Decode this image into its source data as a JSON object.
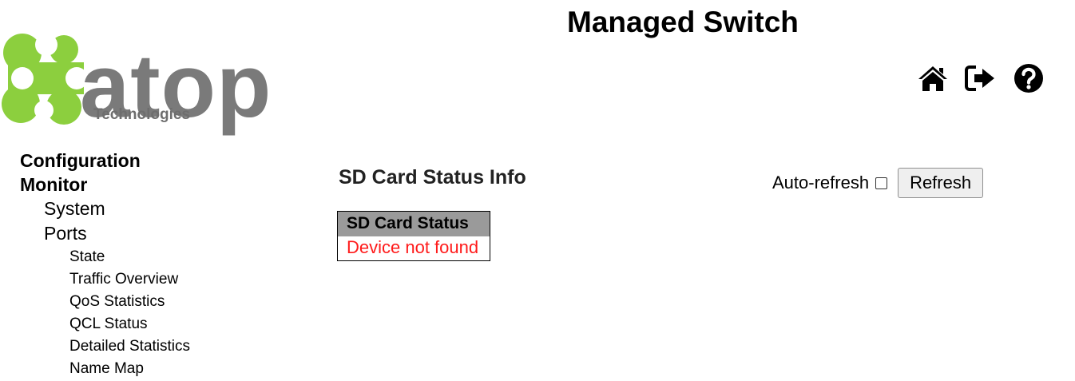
{
  "header": {
    "logo": {
      "word": "atop",
      "sub": "Technologies",
      "brand_color": "#8ccf3e",
      "text_color": "#7a7a7a"
    },
    "title": "Managed Switch",
    "icons": [
      "home-icon",
      "logout-icon",
      "help-icon"
    ]
  },
  "sidebar": {
    "configuration": "Configuration",
    "monitor": "Monitor",
    "system": "System",
    "ports": "Ports",
    "port_items": [
      "State",
      "Traffic Overview",
      "QoS Statistics",
      "QCL Status",
      "Detailed Statistics",
      "Name Map"
    ]
  },
  "main": {
    "title": "SD Card Status Info",
    "auto_refresh_label": "Auto-refresh",
    "auto_refresh_checked": false,
    "refresh_button": "Refresh",
    "table": {
      "header": "SD Card Status",
      "value": "Device not found",
      "value_color": "#ff1a1a",
      "header_bg": "#9a9a9a"
    }
  }
}
